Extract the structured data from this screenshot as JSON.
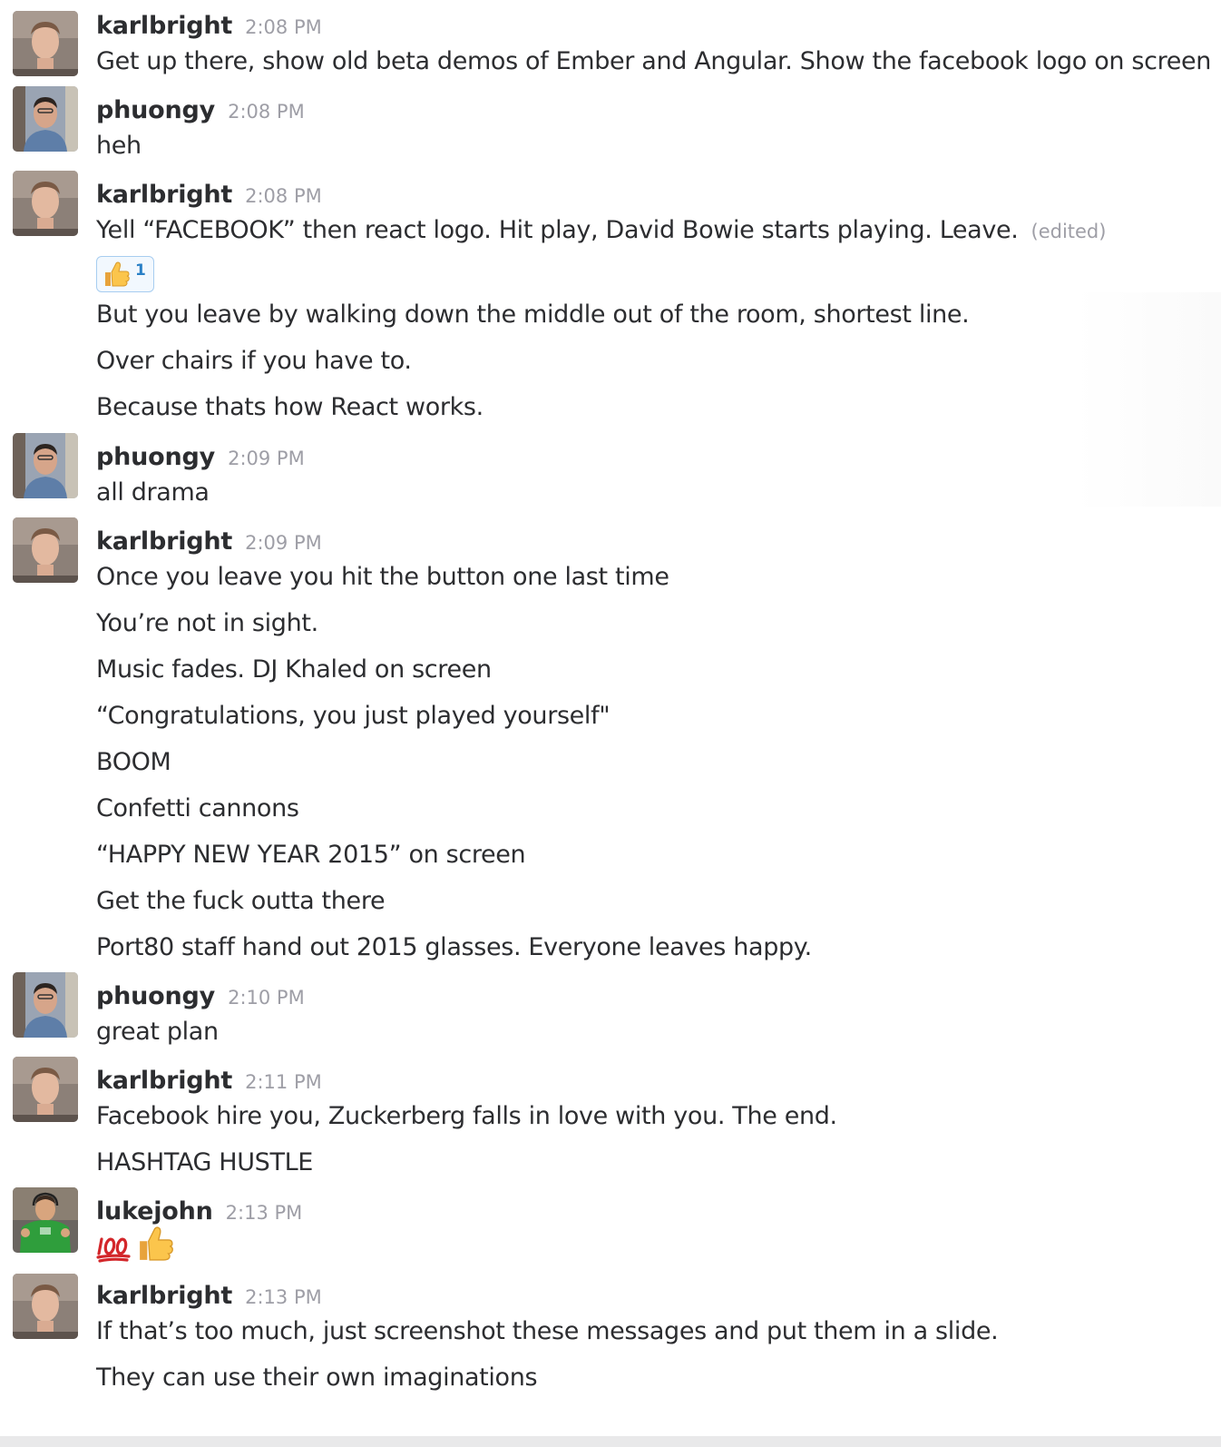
{
  "messages": [
    {
      "author": "karlbright",
      "time": "2:08 PM",
      "lines": [
        "Get up there, show old beta demos of Ember and Angular. Show the facebook logo on screen"
      ]
    },
    {
      "author": "phuongy",
      "time": "2:08 PM",
      "lines": [
        "heh"
      ]
    },
    {
      "author": "karlbright",
      "time": "2:08 PM",
      "lines": [
        "Yell “FACEBOOK” then react logo. Hit play, David Bowie starts playing. Leave."
      ],
      "edited": "(edited)",
      "reaction": {
        "emoji": "thumbs-up",
        "count": "1"
      }
    },
    {
      "lines": [
        "But you leave by walking down the middle out of the room, shortest line.",
        "Over chairs if you have to.",
        "Because thats how React works."
      ]
    },
    {
      "author": "phuongy",
      "time": "2:09 PM",
      "lines": [
        "all drama"
      ]
    },
    {
      "author": "karlbright",
      "time": "2:09 PM",
      "lines": [
        "Once you leave you hit the button one last time",
        "You’re not in sight.",
        "Music fades. DJ Khaled on screen",
        "“Congratulations, you just played yourself\"",
        "BOOM",
        "Confetti cannons",
        "“HAPPY NEW YEAR 2015” on screen",
        "Get the fuck outta there",
        "Port80 staff hand out 2015 glasses. Everyone leaves happy."
      ]
    },
    {
      "author": "phuongy",
      "time": "2:10 PM",
      "lines": [
        "great plan"
      ]
    },
    {
      "author": "karlbright",
      "time": "2:11 PM",
      "lines": [
        "Facebook hire you, Zuckerberg falls in love with you. The end.",
        "HASHTAG HUSTLE"
      ]
    },
    {
      "author": "lukejohn",
      "time": "2:13 PM",
      "emojis": [
        "hundred-points",
        "thumbs-up"
      ]
    },
    {
      "author": "karlbright",
      "time": "2:13 PM",
      "lines": [
        "If that’s too much, just screenshot these messages and put them in a slide.",
        "They can use their own imaginations"
      ]
    }
  ]
}
